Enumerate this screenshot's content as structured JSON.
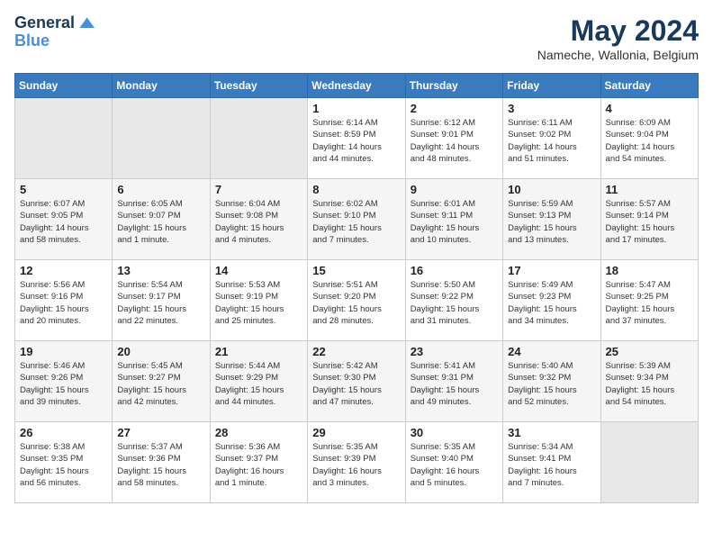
{
  "header": {
    "logo_line1": "General",
    "logo_line2": "Blue",
    "month_year": "May 2024",
    "location": "Nameche, Wallonia, Belgium"
  },
  "weekdays": [
    "Sunday",
    "Monday",
    "Tuesday",
    "Wednesday",
    "Thursday",
    "Friday",
    "Saturday"
  ],
  "weeks": [
    [
      {
        "day": "",
        "info": ""
      },
      {
        "day": "",
        "info": ""
      },
      {
        "day": "",
        "info": ""
      },
      {
        "day": "1",
        "info": "Sunrise: 6:14 AM\nSunset: 8:59 PM\nDaylight: 14 hours\nand 44 minutes."
      },
      {
        "day": "2",
        "info": "Sunrise: 6:12 AM\nSunset: 9:01 PM\nDaylight: 14 hours\nand 48 minutes."
      },
      {
        "day": "3",
        "info": "Sunrise: 6:11 AM\nSunset: 9:02 PM\nDaylight: 14 hours\nand 51 minutes."
      },
      {
        "day": "4",
        "info": "Sunrise: 6:09 AM\nSunset: 9:04 PM\nDaylight: 14 hours\nand 54 minutes."
      }
    ],
    [
      {
        "day": "5",
        "info": "Sunrise: 6:07 AM\nSunset: 9:05 PM\nDaylight: 14 hours\nand 58 minutes."
      },
      {
        "day": "6",
        "info": "Sunrise: 6:05 AM\nSunset: 9:07 PM\nDaylight: 15 hours\nand 1 minute."
      },
      {
        "day": "7",
        "info": "Sunrise: 6:04 AM\nSunset: 9:08 PM\nDaylight: 15 hours\nand 4 minutes."
      },
      {
        "day": "8",
        "info": "Sunrise: 6:02 AM\nSunset: 9:10 PM\nDaylight: 15 hours\nand 7 minutes."
      },
      {
        "day": "9",
        "info": "Sunrise: 6:01 AM\nSunset: 9:11 PM\nDaylight: 15 hours\nand 10 minutes."
      },
      {
        "day": "10",
        "info": "Sunrise: 5:59 AM\nSunset: 9:13 PM\nDaylight: 15 hours\nand 13 minutes."
      },
      {
        "day": "11",
        "info": "Sunrise: 5:57 AM\nSunset: 9:14 PM\nDaylight: 15 hours\nand 17 minutes."
      }
    ],
    [
      {
        "day": "12",
        "info": "Sunrise: 5:56 AM\nSunset: 9:16 PM\nDaylight: 15 hours\nand 20 minutes."
      },
      {
        "day": "13",
        "info": "Sunrise: 5:54 AM\nSunset: 9:17 PM\nDaylight: 15 hours\nand 22 minutes."
      },
      {
        "day": "14",
        "info": "Sunrise: 5:53 AM\nSunset: 9:19 PM\nDaylight: 15 hours\nand 25 minutes."
      },
      {
        "day": "15",
        "info": "Sunrise: 5:51 AM\nSunset: 9:20 PM\nDaylight: 15 hours\nand 28 minutes."
      },
      {
        "day": "16",
        "info": "Sunrise: 5:50 AM\nSunset: 9:22 PM\nDaylight: 15 hours\nand 31 minutes."
      },
      {
        "day": "17",
        "info": "Sunrise: 5:49 AM\nSunset: 9:23 PM\nDaylight: 15 hours\nand 34 minutes."
      },
      {
        "day": "18",
        "info": "Sunrise: 5:47 AM\nSunset: 9:25 PM\nDaylight: 15 hours\nand 37 minutes."
      }
    ],
    [
      {
        "day": "19",
        "info": "Sunrise: 5:46 AM\nSunset: 9:26 PM\nDaylight: 15 hours\nand 39 minutes."
      },
      {
        "day": "20",
        "info": "Sunrise: 5:45 AM\nSunset: 9:27 PM\nDaylight: 15 hours\nand 42 minutes."
      },
      {
        "day": "21",
        "info": "Sunrise: 5:44 AM\nSunset: 9:29 PM\nDaylight: 15 hours\nand 44 minutes."
      },
      {
        "day": "22",
        "info": "Sunrise: 5:42 AM\nSunset: 9:30 PM\nDaylight: 15 hours\nand 47 minutes."
      },
      {
        "day": "23",
        "info": "Sunrise: 5:41 AM\nSunset: 9:31 PM\nDaylight: 15 hours\nand 49 minutes."
      },
      {
        "day": "24",
        "info": "Sunrise: 5:40 AM\nSunset: 9:32 PM\nDaylight: 15 hours\nand 52 minutes."
      },
      {
        "day": "25",
        "info": "Sunrise: 5:39 AM\nSunset: 9:34 PM\nDaylight: 15 hours\nand 54 minutes."
      }
    ],
    [
      {
        "day": "26",
        "info": "Sunrise: 5:38 AM\nSunset: 9:35 PM\nDaylight: 15 hours\nand 56 minutes."
      },
      {
        "day": "27",
        "info": "Sunrise: 5:37 AM\nSunset: 9:36 PM\nDaylight: 15 hours\nand 58 minutes."
      },
      {
        "day": "28",
        "info": "Sunrise: 5:36 AM\nSunset: 9:37 PM\nDaylight: 16 hours\nand 1 minute."
      },
      {
        "day": "29",
        "info": "Sunrise: 5:35 AM\nSunset: 9:39 PM\nDaylight: 16 hours\nand 3 minutes."
      },
      {
        "day": "30",
        "info": "Sunrise: 5:35 AM\nSunset: 9:40 PM\nDaylight: 16 hours\nand 5 minutes."
      },
      {
        "day": "31",
        "info": "Sunrise: 5:34 AM\nSunset: 9:41 PM\nDaylight: 16 hours\nand 7 minutes."
      },
      {
        "day": "",
        "info": ""
      }
    ]
  ]
}
